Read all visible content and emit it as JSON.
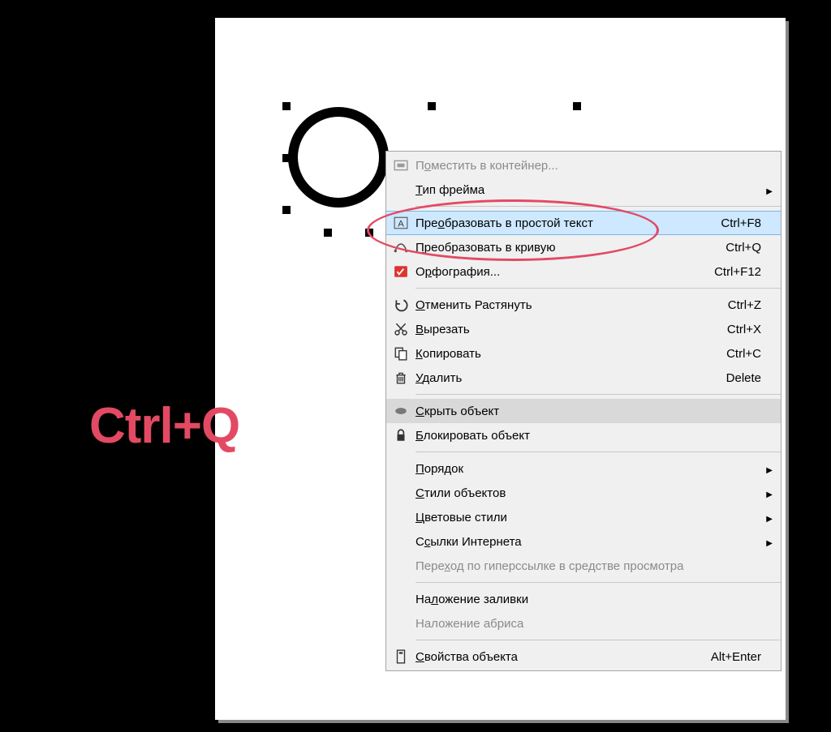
{
  "overlay": {
    "label": "Ctrl+Q"
  },
  "menu": {
    "group1": [
      {
        "id": "place-in-container",
        "label_pre": "П",
        "mn": "о",
        "label_post": "местить в контейнер...",
        "shortcut": "",
        "submenu": false,
        "disabled": true,
        "icon": "container-icon"
      },
      {
        "id": "frame-type",
        "label_pre": "",
        "mn": "Т",
        "label_post": "ип фрейма",
        "shortcut": "",
        "submenu": true,
        "disabled": false,
        "icon": ""
      }
    ],
    "group2": [
      {
        "id": "convert-plain-text",
        "label_pre": "Пре",
        "mn": "о",
        "label_post": "бразовать в простой текст",
        "shortcut": "Ctrl+F8",
        "submenu": false,
        "disabled": false,
        "icon": "text-convert-icon",
        "highlight": true
      },
      {
        "id": "convert-to-curve",
        "label_pre": "",
        "mn": "П",
        "label_post": "реобразовать в кривую",
        "shortcut": "Ctrl+Q",
        "submenu": false,
        "disabled": false,
        "icon": "curve-convert-icon"
      },
      {
        "id": "spelling",
        "label_pre": "О",
        "mn": "р",
        "label_post": "фография...",
        "shortcut": "Ctrl+F12",
        "submenu": false,
        "disabled": false,
        "icon": "spellcheck-icon"
      }
    ],
    "group3": [
      {
        "id": "undo-stretch",
        "label_pre": "",
        "mn": "О",
        "label_post": "тменить Растянуть",
        "shortcut": "Ctrl+Z",
        "submenu": false,
        "disabled": false,
        "icon": "undo-icon"
      },
      {
        "id": "cut",
        "label_pre": "",
        "mn": "В",
        "label_post": "ырезать",
        "shortcut": "Ctrl+X",
        "submenu": false,
        "disabled": false,
        "icon": "cut-icon"
      },
      {
        "id": "copy",
        "label_pre": "",
        "mn": "К",
        "label_post": "опировать",
        "shortcut": "Ctrl+C",
        "submenu": false,
        "disabled": false,
        "icon": "copy-icon"
      },
      {
        "id": "delete",
        "label_pre": "",
        "mn": "У",
        "label_post": "далить",
        "shortcut": "Delete",
        "submenu": false,
        "disabled": false,
        "icon": "trash-icon"
      }
    ],
    "group4": [
      {
        "id": "hide-object",
        "label_pre": "",
        "mn": "С",
        "label_post": "крыть объект",
        "shortcut": "",
        "submenu": false,
        "disabled": false,
        "icon": "ellipse-icon",
        "hover": true
      },
      {
        "id": "lock-object",
        "label_pre": "",
        "mn": "Б",
        "label_post": "локировать объект",
        "shortcut": "",
        "submenu": false,
        "disabled": false,
        "icon": "lock-icon"
      }
    ],
    "group5": [
      {
        "id": "order",
        "label_pre": "",
        "mn": "П",
        "label_post": "орядок",
        "shortcut": "",
        "submenu": true,
        "disabled": false,
        "icon": ""
      },
      {
        "id": "object-styles",
        "label_pre": "",
        "mn": "С",
        "label_post": "тили объектов",
        "shortcut": "",
        "submenu": true,
        "disabled": false,
        "icon": ""
      },
      {
        "id": "color-styles",
        "label_pre": "",
        "mn": "Ц",
        "label_post": "ветовые стили",
        "shortcut": "",
        "submenu": true,
        "disabled": false,
        "icon": ""
      },
      {
        "id": "internet-links",
        "label_pre": "С",
        "mn": "с",
        "label_post": "ылки Интернета",
        "shortcut": "",
        "submenu": true,
        "disabled": false,
        "icon": ""
      },
      {
        "id": "hyperlink-viewer",
        "label_pre": "Пере",
        "mn": "х",
        "label_post": "од по гиперссылке в средстве просмотра",
        "shortcut": "",
        "submenu": false,
        "disabled": true,
        "icon": ""
      }
    ],
    "group6": [
      {
        "id": "fill-overprint",
        "label_pre": "На",
        "mn": "л",
        "label_post": "ожение заливки",
        "shortcut": "",
        "submenu": false,
        "disabled": false,
        "icon": ""
      },
      {
        "id": "outline-overprint",
        "label_pre": "Наложение абриса",
        "mn": "",
        "label_post": "",
        "shortcut": "",
        "submenu": false,
        "disabled": true,
        "icon": ""
      }
    ],
    "group7": [
      {
        "id": "object-properties",
        "label_pre": "",
        "mn": "С",
        "label_post": "войства объекта",
        "shortcut": "Alt+Enter",
        "submenu": false,
        "disabled": false,
        "icon": "properties-icon"
      }
    ]
  }
}
